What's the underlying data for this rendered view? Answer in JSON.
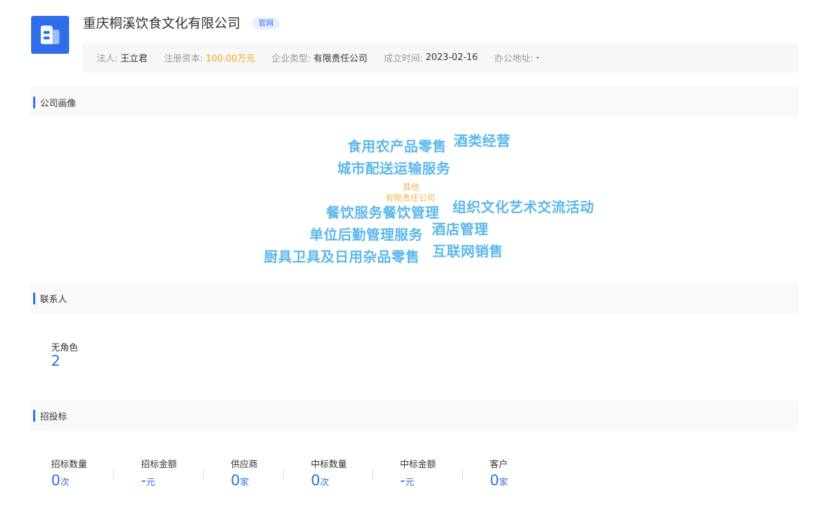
{
  "company": {
    "name": "重庆桐溪饮食文化有限公司",
    "official_tag": "官网",
    "logo_icon": "building-icon",
    "brand_color": "#2f6ee8"
  },
  "info": [
    {
      "label": "法人:",
      "value": "王立君"
    },
    {
      "label": "注册资本:",
      "value": "100.00万元",
      "highlight": true
    },
    {
      "label": "企业类型:",
      "value": "有限责任公司"
    },
    {
      "label": "成立时间:",
      "value": "2023-02-16"
    },
    {
      "label": "办公地址:",
      "value": "-"
    }
  ],
  "sections": {
    "portrait": "公司画像",
    "contacts": "联系人",
    "bidding": "招投标"
  },
  "word_cloud": [
    "食用农产品零售",
    "酒类经营",
    "城市配送运输服务",
    "其他",
    "有限责任公司",
    "餐饮服务餐饮管理",
    "组织文化艺术交流活动",
    "单位后勤管理服务",
    "酒店管理",
    "厨具卫具及日用杂品零售",
    "互联网销售"
  ],
  "contacts": {
    "role": "无角色",
    "count": "2"
  },
  "bidding_stats": [
    {
      "label": "招标数量",
      "value": "0",
      "unit": "次"
    },
    {
      "label": "招标金额",
      "value": "-",
      "unit": "元"
    },
    {
      "label": "供应商",
      "value": "0",
      "unit": "家"
    },
    {
      "label": "中标数量",
      "value": "0",
      "unit": "次"
    },
    {
      "label": "中标金额",
      "value": "-",
      "unit": "元"
    },
    {
      "label": "客户",
      "value": "0",
      "unit": "家"
    }
  ]
}
